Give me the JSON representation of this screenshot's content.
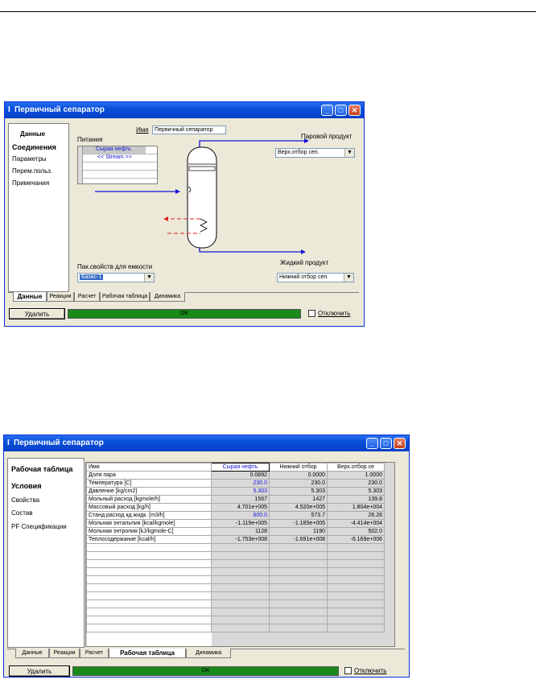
{
  "colors": {
    "titlebar": "#0850d8",
    "status_ok": "#1a8a1a",
    "stream_blue": "#1313d4",
    "energy_red": "#e02020"
  },
  "window1": {
    "title": "Первичный сепаратор",
    "nav": {
      "header": "Данные",
      "items": [
        "Соединения",
        "Параметры",
        "Перем.польз.",
        "Примечания"
      ]
    },
    "name_label": "Имя",
    "name_value": "Первичный сепаратор",
    "feeds_label": "Питания",
    "feed_stream": "Сырая нефть",
    "feed_new": "<< Stream >>",
    "vapor_label": "Паровой продукт",
    "vapor_value": "Верх.отбор сеп.",
    "liquid_label": "Жидкий продукт",
    "liquid_value": "Нижний отбор сеп.",
    "pkg_label": "Пак.свойств для емкости",
    "pkg_value": "Базис-1",
    "tabs": [
      "Данные",
      "Реакции",
      "Расчет",
      "Рабочая таблица",
      "Динамика"
    ],
    "active_tab": "Данные",
    "delete_label": "Удалить",
    "status": "OK",
    "disable_label": "Отключить"
  },
  "window2": {
    "title": "Первичный сепаратор",
    "nav": {
      "header": "Рабочая таблица",
      "items": [
        "Условия",
        "Свойства",
        "Состав",
        "PF Спецификации"
      ]
    },
    "table": {
      "headers": [
        "Имя",
        "Сырая нефть",
        "Нижний отбор",
        "Верх.отбор се"
      ],
      "rows": [
        [
          "Доля пара",
          "0.0892",
          "0.0000",
          "1.0000"
        ],
        [
          "Температура [C]",
          "230.0",
          "230.0",
          "230.0"
        ],
        [
          "Давление [kg/cm2]",
          "5.303",
          "5.303",
          "5.303"
        ],
        [
          "Мольный расход [kgmole/h]",
          "1567",
          "1427",
          "139.8"
        ],
        [
          "Массовый расход [kg/h]",
          "4.701e+005",
          "4.520e+005",
          "1.804e+004"
        ],
        [
          "Станд.расход кд.жидк. [m3/h]",
          "600.0",
          "573.7",
          "26.26"
        ],
        [
          "Мольная энтальпия [kcal/kgmole]",
          "-1.119e+005",
          "-1.185e+005",
          "-4.414e+004"
        ],
        [
          "Мольная энтропия [kJ/kgmole-C]",
          "1128",
          "1190",
          "502.0"
        ],
        [
          "Теплосодержание [kcal/h]",
          "-1.753e+008",
          "-1.691e+008",
          "-6.169e+006"
        ]
      ]
    },
    "tabs": [
      "Данные",
      "Реакции",
      "Расчет",
      "Рабочая таблица",
      "Динамика"
    ],
    "active_tab": "Рабочая таблица",
    "delete_label": "Удалить",
    "status": "OK",
    "disable_label": "Отключить"
  }
}
